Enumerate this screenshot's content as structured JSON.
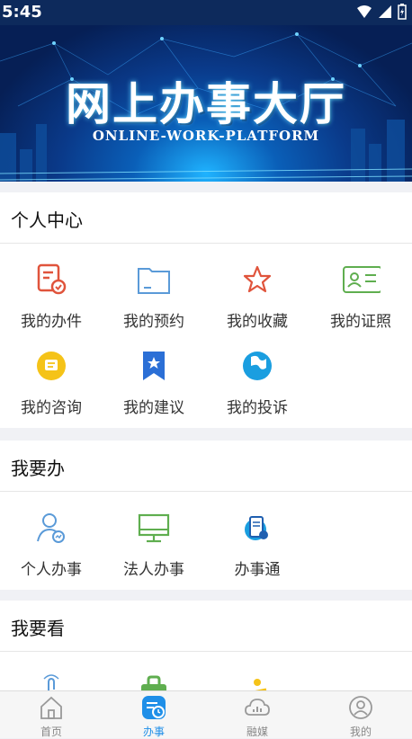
{
  "status_bar": {
    "time": "5:45"
  },
  "banner": {
    "title": "网上办事大厅",
    "subtitle": "ONLINE-WORK-PLATFORM"
  },
  "sections": [
    {
      "title": "个人中心",
      "items": [
        {
          "label": "我的办件",
          "icon": "document-check-icon"
        },
        {
          "label": "我的预约",
          "icon": "folder-icon"
        },
        {
          "label": "我的收藏",
          "icon": "star-icon"
        },
        {
          "label": "我的证照",
          "icon": "id-card-icon"
        },
        {
          "label": "我的咨询",
          "icon": "chat-bubble-icon"
        },
        {
          "label": "我的建议",
          "icon": "bookmark-icon"
        },
        {
          "label": "我的投诉",
          "icon": "flag-icon"
        }
      ]
    },
    {
      "title": "我要办",
      "items": [
        {
          "label": "个人办事",
          "icon": "person-icon"
        },
        {
          "label": "法人办事",
          "icon": "monitor-icon"
        },
        {
          "label": "办事通",
          "icon": "phone-service-icon"
        }
      ]
    },
    {
      "title": "我要看",
      "items": [
        {
          "label": "",
          "icon": "hand-tap-icon"
        },
        {
          "label": "",
          "icon": "briefcase-icon"
        },
        {
          "label": "",
          "icon": "person-bench-icon"
        }
      ]
    }
  ],
  "tab_bar": [
    {
      "label": "首页",
      "icon": "home-icon",
      "active": false
    },
    {
      "label": "办事",
      "icon": "task-clock-icon",
      "active": true
    },
    {
      "label": "融媒",
      "icon": "cloud-chart-icon",
      "active": false
    },
    {
      "label": "我的",
      "icon": "user-circle-icon",
      "active": false
    }
  ],
  "colors": {
    "accent": "#1f8fe8",
    "red": "#e0543c",
    "blue": "#5a9ad8",
    "green": "#5fae4f",
    "yellow": "#f5c318"
  }
}
